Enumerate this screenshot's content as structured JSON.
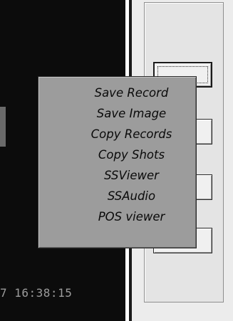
{
  "viewer": {
    "timestamp": "7 16:38:15"
  },
  "context_menu": {
    "items": [
      {
        "label": "Save Record"
      },
      {
        "label": "Save Image"
      },
      {
        "label": "Copy Records"
      },
      {
        "label": "Copy Shots"
      },
      {
        "label": "SSViewer"
      },
      {
        "label": "SSAudio"
      },
      {
        "label": "POS viewer"
      }
    ]
  },
  "colors": {
    "viewer_background": "#0c0c0c",
    "timestamp_text": "#9c9c9c",
    "menu_background": "#9c9c9c",
    "menu_text": "#0a0a0a",
    "panel_background": "#ececec"
  }
}
